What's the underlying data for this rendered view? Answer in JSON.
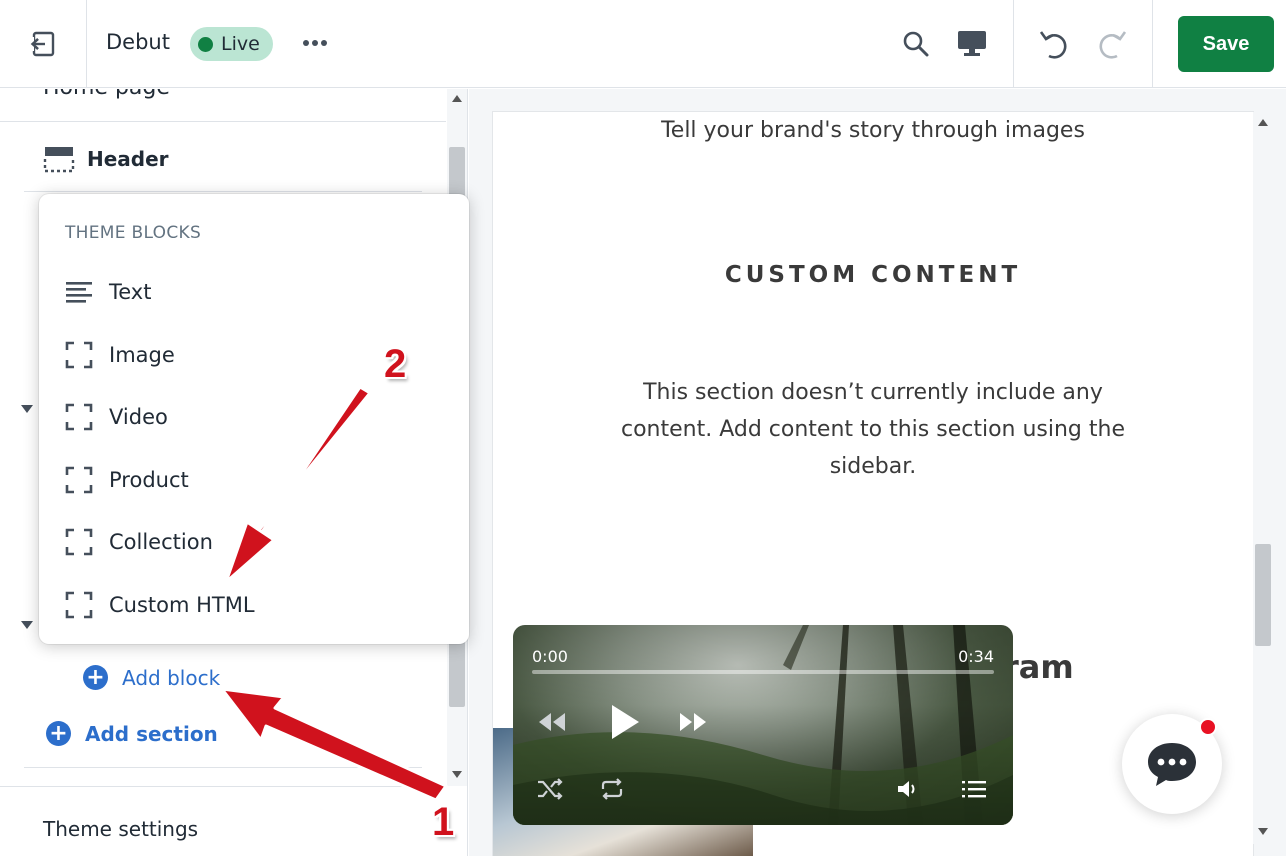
{
  "topbar": {
    "theme_name": "Debut",
    "live_label": "Live",
    "save_label": "Save"
  },
  "sidebar": {
    "page_heading": "Home page",
    "header_label": "Header",
    "add_block_label": "Add block",
    "add_section_label": "Add section",
    "theme_settings_label": "Theme settings"
  },
  "popover": {
    "title": "THEME BLOCKS",
    "items": [
      {
        "label": "Text",
        "icon": "text-lines-icon"
      },
      {
        "label": "Image",
        "icon": "dashed-bracket-icon"
      },
      {
        "label": "Video",
        "icon": "dashed-bracket-icon"
      },
      {
        "label": "Product",
        "icon": "dashed-bracket-icon"
      },
      {
        "label": "Collection",
        "icon": "dashed-bracket-icon"
      },
      {
        "label": "Custom HTML",
        "icon": "dashed-bracket-icon"
      }
    ]
  },
  "preview": {
    "intro_text": "Tell your brand's story through images",
    "section_heading": "CUSTOM CONTENT",
    "section_body": "This section doesn’t currently include any content. Add content to this section using the sidebar.",
    "partial_heading": "ram"
  },
  "player": {
    "current_time": "0:00",
    "duration": "0:34",
    "progress_fraction": 0
  },
  "annotations": {
    "step_1": "1",
    "step_2": "2"
  },
  "colors": {
    "accent_green": "#108043",
    "live_badge_bg": "#bbe5d3",
    "link_blue": "#2c6ecb",
    "annotation_red": "#d0121d",
    "notification_red": "#e81123"
  }
}
